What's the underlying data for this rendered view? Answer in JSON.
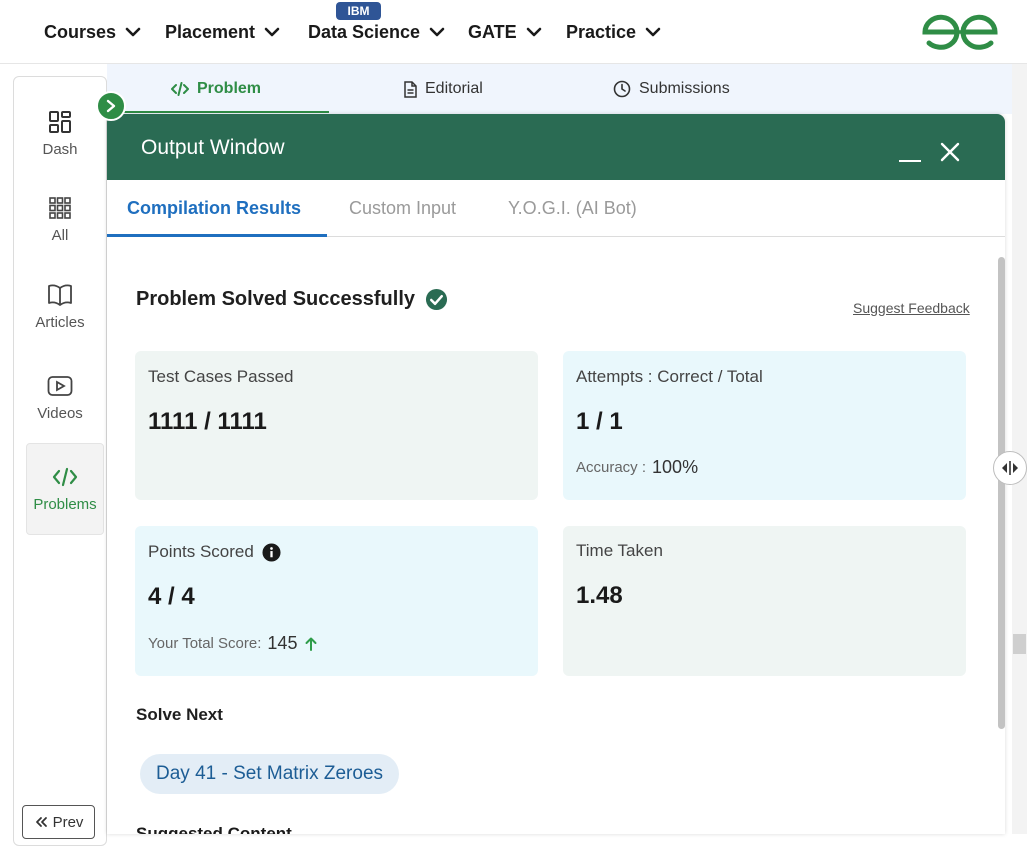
{
  "nav": {
    "items": [
      {
        "label": "Courses"
      },
      {
        "label": "Placement"
      },
      {
        "label": "Data Science"
      },
      {
        "label": "GATE"
      },
      {
        "label": "Practice"
      }
    ],
    "badge": "IBM",
    "logo_icon": "gfg-logo-icon",
    "brand_color": "#2f8d46"
  },
  "sidebar": {
    "items": [
      {
        "label": "Dash",
        "icon": "dashboard-icon"
      },
      {
        "label": "All",
        "icon": "grid-icon"
      },
      {
        "label": "Articles",
        "icon": "book-icon"
      },
      {
        "label": "Videos",
        "icon": "video-icon"
      },
      {
        "label": "Problems",
        "icon": "code-icon",
        "active": true
      }
    ],
    "prev_label": "Prev"
  },
  "problem_tabs": [
    {
      "label": "Problem",
      "icon": "code-icon",
      "active": true
    },
    {
      "label": "Editorial",
      "icon": "document-icon"
    },
    {
      "label": "Submissions",
      "icon": "clock-icon"
    }
  ],
  "output_window": {
    "title": "Output Window",
    "header_color": "#2a6b53",
    "tabs": [
      {
        "label": "Compilation Results",
        "active": true
      },
      {
        "label": "Custom Input"
      },
      {
        "label": "Y.O.G.I. (AI Bot)"
      }
    ],
    "status": "Problem Solved Successfully",
    "feedback_link": "Suggest Feedback",
    "cards": {
      "test_cases": {
        "label": "Test Cases Passed",
        "value": "1111 / 1111"
      },
      "attempts": {
        "label": "Attempts : Correct / Total",
        "value": "1 / 1",
        "sub_label": "Accuracy :",
        "sub_value": "100%"
      },
      "points": {
        "label": "Points Scored",
        "value": "4 / 4",
        "sub_label": "Your Total Score:",
        "sub_value": "145"
      },
      "time": {
        "label": "Time Taken",
        "value": "1.48"
      }
    },
    "solve_next_label": "Solve Next",
    "next_problem": "Day 41 - Set Matrix Zeroes",
    "partial_heading": "Suggested Content"
  }
}
